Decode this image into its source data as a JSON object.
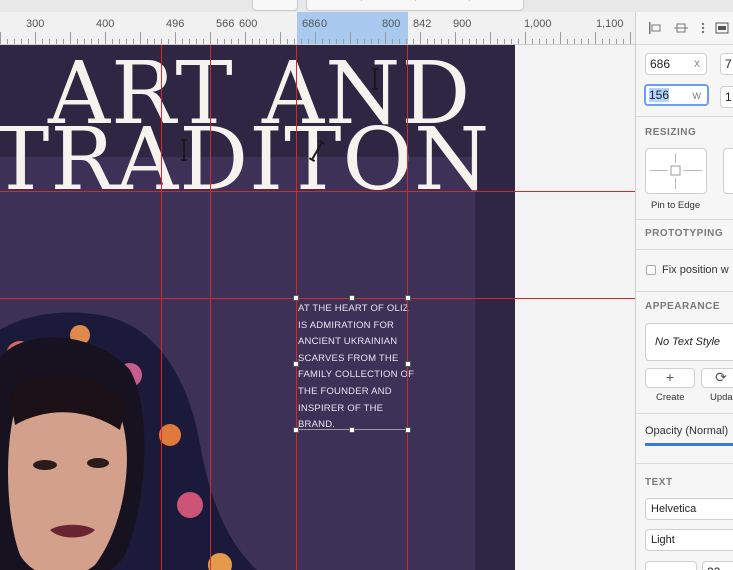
{
  "toolbar": {
    "colors": {
      "accent": "#7ad3c4"
    }
  },
  "ruler": {
    "labels": [
      "300",
      "400",
      "496",
      "566",
      "600",
      "686",
      "0",
      "800",
      "842",
      "900",
      "1,000",
      "1,100"
    ],
    "selection_color": "#a9caef"
  },
  "artboard": {
    "title_line1": "ART AND",
    "title_line2": "TRADITON",
    "body_text": "AT THE HEART OF OLIZ IS ADMIRATION FOR ANCIENT UKRAINIAN SCARVES FROM THE FAMILY COLLECTION OF THE FOUNDER AND INSPIRER OF THE BRAND.",
    "background_color": "#2e2642",
    "guide_color": "#d8262a"
  },
  "inspector": {
    "x_value": "686",
    "x_suffix": "X",
    "y_value": "7",
    "w_value": "156",
    "w_suffix": "W",
    "h_value": "1",
    "sections": {
      "resizing": "RESIZING",
      "prototyping": "PROTOTYPING",
      "appearance": "APPEARANCE",
      "text": "TEXT"
    },
    "pin_to_edge_label": "Pin to Edge",
    "fix_position_label": "Fix position w",
    "text_style_value": "No Text Style",
    "create_label": "Create",
    "update_label": "Upda",
    "opacity_label": "Opacity (Normal)",
    "font_family": "Helvetica",
    "font_weight": "Light",
    "font_size_value": "22",
    "more_icon": "⋮"
  }
}
